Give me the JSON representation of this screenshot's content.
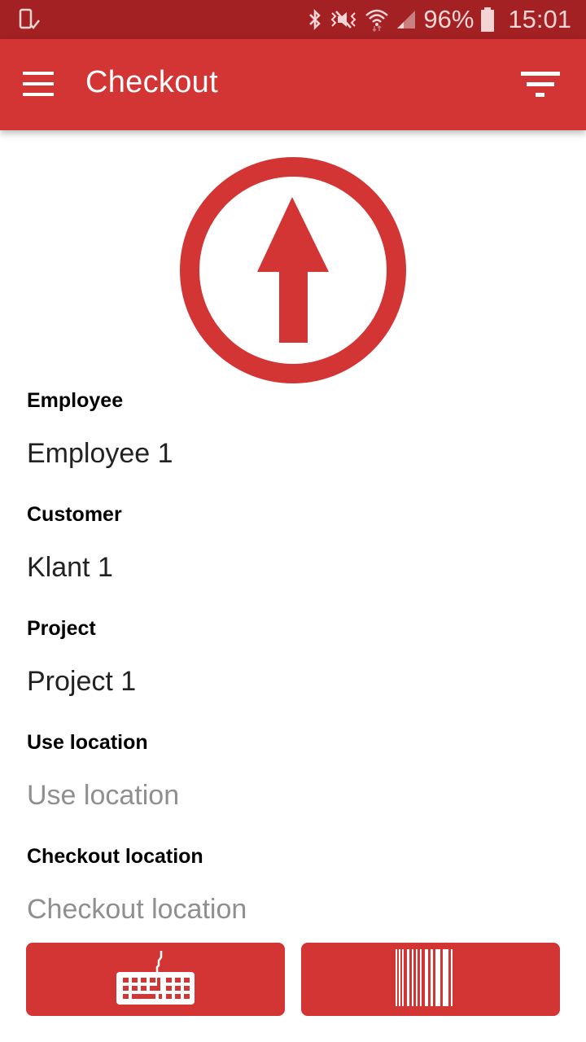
{
  "status_bar": {
    "notification_icon": "device-check-icon",
    "icons": [
      "bluetooth-icon",
      "vibrate-mute-icon",
      "wifi-icon",
      "signal-icon"
    ],
    "battery_percent": "96%",
    "battery_icon": "battery-icon",
    "time": "15:01"
  },
  "app_bar": {
    "menu_icon": "hamburger-menu-icon",
    "title": "Checkout",
    "filter_icon": "filter-icon"
  },
  "hero": {
    "icon": "checkout-arrow-up-circle-icon"
  },
  "form": {
    "fields": [
      {
        "label": "Employee",
        "value": "Employee 1",
        "is_placeholder": false
      },
      {
        "label": "Customer",
        "value": "Klant 1",
        "is_placeholder": false
      },
      {
        "label": "Project",
        "value": "Project 1",
        "is_placeholder": false
      },
      {
        "label": "Use location",
        "value": "Use location",
        "is_placeholder": true
      },
      {
        "label": "Checkout location",
        "value": "Checkout location",
        "is_placeholder": true
      }
    ]
  },
  "actions": {
    "keyboard_icon": "keyboard-icon",
    "barcode_icon": "barcode-icon"
  },
  "colors": {
    "primary": "#d33434",
    "status_bar": "#a32023",
    "placeholder_text": "#8f8f8f"
  }
}
